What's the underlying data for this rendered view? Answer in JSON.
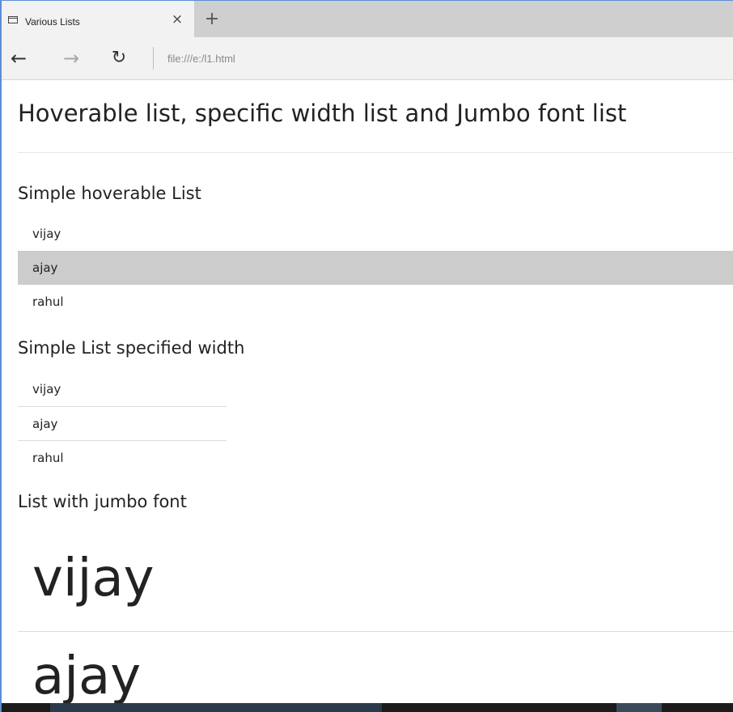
{
  "tab": {
    "title": "Various Lists",
    "close_glyph": "×",
    "new_tab_glyph": "+"
  },
  "nav": {
    "back_glyph": "←",
    "forward_glyph": "→",
    "refresh_glyph": "↻",
    "address": "file:///e:/l1.html"
  },
  "page": {
    "title": "Hoverable list, specific width list and Jumbo font list",
    "sections": {
      "hoverable": {
        "heading": "Simple hoverable List",
        "items": [
          "vijay",
          "ajay",
          "rahul"
        ],
        "hovered_index": 1
      },
      "specified_width": {
        "heading": "Simple List specified width",
        "items": [
          "vijay",
          "ajay",
          "rahul"
        ]
      },
      "jumbo": {
        "heading": "List with jumbo font",
        "items": [
          "vijay",
          "ajay"
        ]
      }
    }
  },
  "colors": {
    "hover_background": "#cccccc",
    "window_border": "#5b8ed6",
    "tabstrip_background": "#cfcfcf",
    "toolbar_background": "#f2f2f2"
  },
  "icons": {
    "tab": "window-icon",
    "close": "close-icon",
    "new_tab": "plus-icon",
    "back": "back-arrow-icon",
    "forward": "forward-arrow-icon",
    "refresh": "refresh-icon"
  }
}
